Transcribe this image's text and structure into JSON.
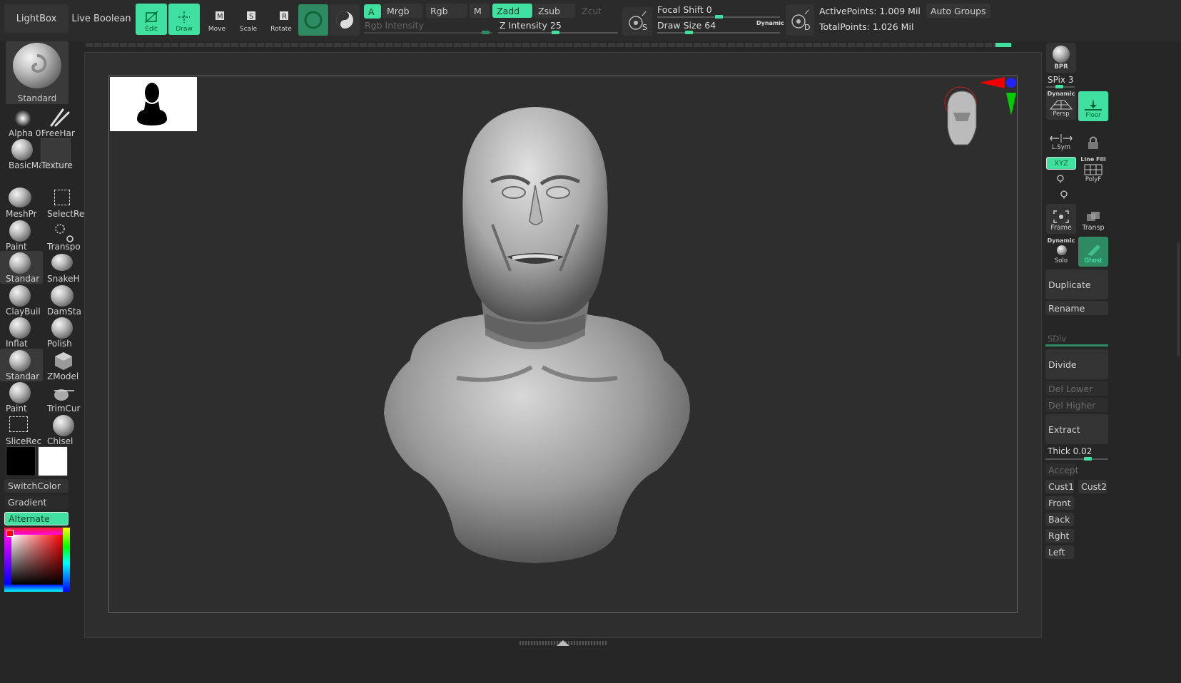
{
  "topbar": {
    "lightbox": "LightBox",
    "live_boolean": "Live Boolean",
    "tools": [
      {
        "label": "Edit",
        "active": true
      },
      {
        "label": "Draw",
        "active": true
      },
      {
        "label": "Move",
        "active": false
      },
      {
        "label": "Scale",
        "active": false
      },
      {
        "label": "Rotate",
        "active": false
      }
    ],
    "channels": {
      "a": "A",
      "mrgb": "Mrgb",
      "rgb": "Rgb",
      "m": "M",
      "zadd": "Zadd",
      "zsub": "Zsub",
      "zcut": "Zcut"
    },
    "rgb_intensity": "Rgb Intensity",
    "z_intensity": "Z Intensity 25",
    "focal_shift": "Focal Shift 0",
    "draw_size": "Draw Size 64",
    "dynamic": "Dynamic",
    "active_points": "ActivePoints: 1.009 Mil",
    "total_points": "TotalPoints: 1.026 Mil",
    "auto_groups": "Auto Groups",
    "s_label": "S",
    "d_label": "D",
    "accent_color": "#3fe0a0"
  },
  "leftshelf": {
    "current_brush": "Standard",
    "alpha": "Alpha 0'",
    "stroke": "FreeHar",
    "material": "BasicMa",
    "texture": "Texture",
    "brushes": [
      {
        "label": "MeshPr"
      },
      {
        "label": "SelectRe"
      },
      {
        "label": "Paint"
      },
      {
        "label": "Transpo"
      },
      {
        "label": "Standar"
      },
      {
        "label": "SnakeH"
      },
      {
        "label": "ClayBuil"
      },
      {
        "label": "DamSta"
      },
      {
        "label": "Inflat"
      },
      {
        "label": "Polish"
      },
      {
        "label": "Standar"
      },
      {
        "label": "ZModel"
      },
      {
        "label": "Paint"
      },
      {
        "label": "TrimCur"
      },
      {
        "label": "SliceRec"
      },
      {
        "label": "Chisel"
      }
    ],
    "switch_color": "SwitchColor",
    "gradient": "Gradient",
    "alternate": "Alternate",
    "main_color": "#000000",
    "secondary_color": "#ffffff"
  },
  "rightshelf": {
    "bpr": "BPR",
    "spix": "SPix 3",
    "persp_top": "Dynamic",
    "persp": "Persp",
    "floor": "Floor",
    "lsym": "L.Sym",
    "xyz": "XYZ",
    "linefill_top": "Line Fill",
    "polyf": "PolyF",
    "frame": "Frame",
    "transp": "Transp",
    "solo_top": "Dynamic",
    "solo": "Solo",
    "ghost": "Ghost",
    "duplicate": "Duplicate",
    "rename": "Rename",
    "sdiv": "SDiv",
    "divide": "Divide",
    "del_lower": "Del Lower",
    "del_higher": "Del Higher",
    "extract": "Extract",
    "thick": "Thick 0.02",
    "accept": "Accept",
    "cust1": "Cust1",
    "cust2": "Cust2",
    "front": "Front",
    "back": "Back",
    "right": "Rght",
    "left": "Left"
  }
}
